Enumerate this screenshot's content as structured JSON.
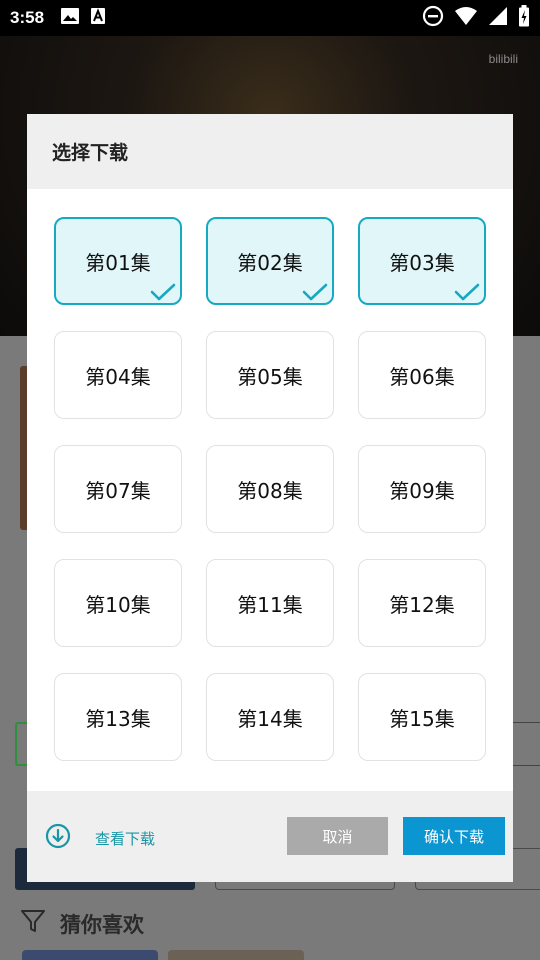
{
  "status_bar": {
    "time": "3:58",
    "icons": [
      "image-icon",
      "a-font-icon",
      "do-not-disturb-icon",
      "wifi-icon",
      "signal-icon",
      "battery-icon"
    ]
  },
  "background": {
    "logo": "bilibili",
    "section_title": "猜你喜欢",
    "section_icon": "filter-icon"
  },
  "dialog": {
    "title": "选择下载",
    "episodes": [
      {
        "label": "第01集",
        "selected": true
      },
      {
        "label": "第02集",
        "selected": true
      },
      {
        "label": "第03集",
        "selected": true
      },
      {
        "label": "第04集",
        "selected": false
      },
      {
        "label": "第05集",
        "selected": false
      },
      {
        "label": "第06集",
        "selected": false
      },
      {
        "label": "第07集",
        "selected": false
      },
      {
        "label": "第08集",
        "selected": false
      },
      {
        "label": "第09集",
        "selected": false
      },
      {
        "label": "第10集",
        "selected": false
      },
      {
        "label": "第11集",
        "selected": false
      },
      {
        "label": "第12集",
        "selected": false
      },
      {
        "label": "第13集",
        "selected": false
      },
      {
        "label": "第14集",
        "selected": false
      },
      {
        "label": "第15集",
        "selected": false
      }
    ],
    "footer": {
      "view_downloads_label": "查看下载",
      "view_downloads_icon": "download-circle-icon",
      "cancel_label": "取消",
      "confirm_label": "确认下载"
    }
  },
  "colors": {
    "accent": "#16a9c2",
    "confirm_button": "#0b96d2",
    "cancel_button": "#aaaaaa",
    "selected_bg": "#e1f6f9"
  }
}
